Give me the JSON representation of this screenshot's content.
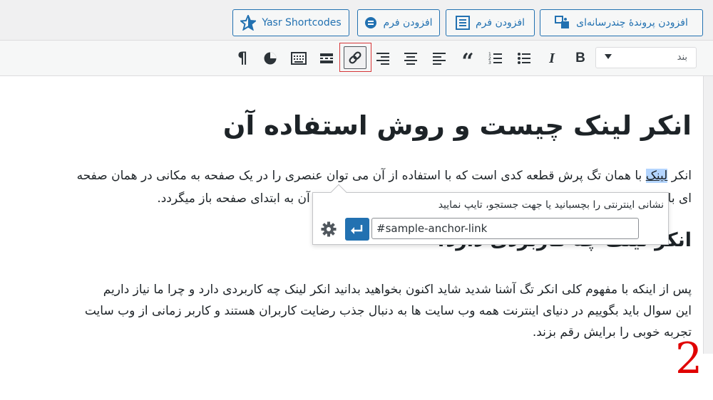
{
  "media_buttons": [
    {
      "name": "add-media-button",
      "label": "افزودن پروندهٔ چندرسانه‌ای",
      "icon": "media-icon"
    },
    {
      "name": "add-form-button",
      "label": "افزودن فرم",
      "icon": "form-list-icon"
    },
    {
      "name": "add-form-button-2",
      "label": "افزودن فرم",
      "icon": "form-circle-icon"
    },
    {
      "name": "yasr-shortcodes-button",
      "label": "Yasr Shortcodes",
      "icon": "star-icon"
    }
  ],
  "toolbar": {
    "format_value": "بند",
    "buttons": [
      "bold-icon",
      "italic-icon",
      "bullet-list-icon",
      "numbered-list-icon",
      "blockquote-icon",
      "align-left-icon",
      "align-center-icon",
      "align-right-icon",
      "link-icon",
      "read-more-icon",
      "toolbar-toggle-icon",
      "pie-icon",
      "paragraph-icon"
    ],
    "active": "link-icon"
  },
  "content": {
    "heading1": "انکر لینک چیست و روش استفاده آن",
    "para1_line1_before": "انکر ",
    "para1_line1_selected": "لینک",
    "para1_line1_after": " با همان تگ پرش قطعه کدی است که با استفاده از آن می توان عنصری را در یک صفحه به مکانی در همان صفحه",
    "para1_line2_start": "ای با",
    "para1_line2_end": "ک بر روی آن به ابتدای صفحه باز میگردد.",
    "heading2": "انکر لینک چه کاربردی دارد؟",
    "para2_line1": "پس از اینکه با مفهوم کلی انکر تگ آشنا شدید شاید اکنون بخواهید بدانید انکر لینک چه کاربردی دارد و چرا ما نیاز داریم",
    "para2_line2": "این سوال باید بگوییم در دنیای اینترنت همه وب سایت ها به دنبال جذب رضایت کاربران هستند و کاربر زمانی از وب سایت",
    "para2_line3": "تجربه خوبی را برایش رقم بزند."
  },
  "link_popup": {
    "hint": "نشانی اینترنتی را بچسبانید یا جهت جستجو، تایپ نمایید",
    "url_value": "#sample-anchor-link",
    "apply_icon": "enter-icon",
    "settings_icon": "gear-icon"
  },
  "step_number": "2",
  "colors": {
    "accent": "#2271b1",
    "highlight": "#d63638",
    "step": "#e00000"
  }
}
